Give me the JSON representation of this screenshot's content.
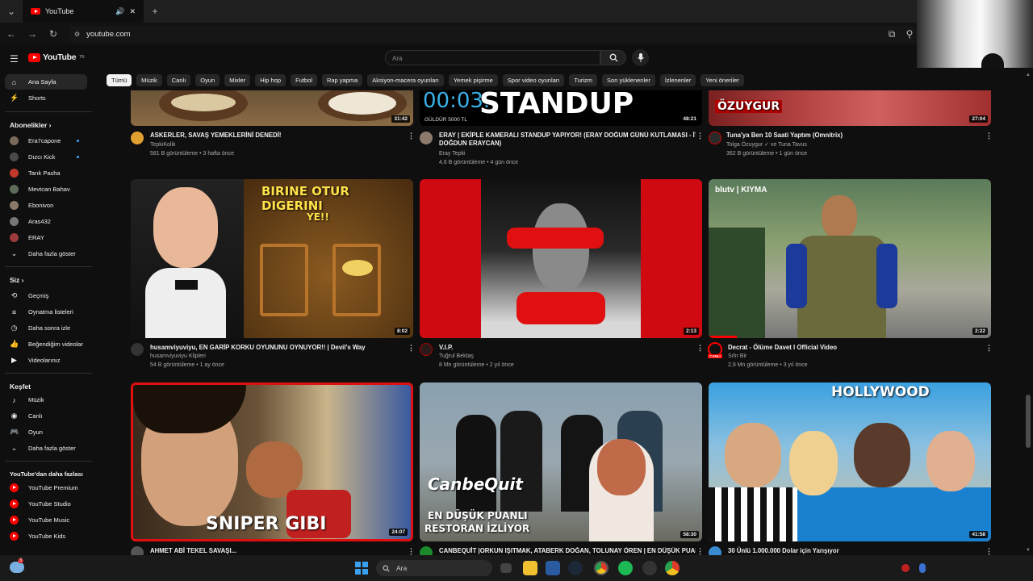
{
  "browser": {
    "tab_title": "YouTube",
    "url": "youtube.com"
  },
  "header": {
    "logo_text": "YouTube",
    "logo_country": "TR",
    "search_placeholder": "Ara"
  },
  "chips": [
    "Tümü",
    "Müzik",
    "Canlı",
    "Oyun",
    "Mixler",
    "Hip hop",
    "Futbol",
    "Rap yapma",
    "Aksiyon-macera oyunları",
    "Yemek pişirme",
    "Spor video oyunları",
    "Turizm",
    "Son yüklenenler",
    "İzlenenler",
    "Yeni öneriler"
  ],
  "sidebar": {
    "home": "Ana Sayfa",
    "shorts": "Shorts",
    "subs_header": "Abonelikler",
    "subs": [
      {
        "name": "Era7capone",
        "color": "#7a6a5a",
        "live": true
      },
      {
        "name": "Dızcı Kick",
        "color": "#4a4a4a",
        "live": true
      },
      {
        "name": "Tarık Pasha",
        "color": "#c0392b",
        "live": false
      },
      {
        "name": "Mevtcan Bahav",
        "color": "#5d6d5a",
        "live": false
      },
      {
        "name": "Ebonivon",
        "color": "#8a7a6a",
        "live": false
      },
      {
        "name": "Aras432",
        "color": "#777777",
        "live": false
      },
      {
        "name": "ERAY",
        "color": "#9b3b3b",
        "live": false
      }
    ],
    "subs_more": "Daha fazla göster",
    "you_header": "Siz",
    "you_items": [
      "Geçmiş",
      "Oynatma listeleri",
      "Daha sonra izle",
      "Beğendiğim videolar",
      "Videolarınız"
    ],
    "explore_header": "Keşfet",
    "explore_items": [
      "Müzik",
      "Canlı",
      "Oyun"
    ],
    "explore_more": "Daha fazla göster",
    "more_header": "YouTube'dan daha fazlası",
    "more_items": [
      "YouTube Premium",
      "YouTube Studio",
      "YouTube Music",
      "YouTube Kids"
    ]
  },
  "videos_row1": [
    {
      "title": "ASKERLER, SAVAŞ YEMEKLERİNİ DENEDİ!",
      "title2": "",
      "channel": "TepkiKolik",
      "meta": "581 B görüntüleme • 3 hafta önce",
      "duration": "31:42"
    },
    {
      "title": "ERAY | EKİPLE KAMERALI STANDUP YAPIYOR! (ERAY DOĞUM GÜNÜ KUTLAMASI - İYİKİ",
      "title2": "DOĞDUN ERAYCAN)",
      "channel": "Eray Tepki",
      "meta": "4,6 B görüntüleme • 4 gün önce",
      "duration": "48:21",
      "overlay": "STANDUP",
      "overlay_timer": "00:03.",
      "overlay_sub": "GÜLDÜR 5000 TL"
    },
    {
      "title": "Tuna'ya Ben 10 Saati Yaptım (Omnitrix)",
      "title2": "",
      "channel": "Tolga Özuygur ✓ ve Tuna Tavus",
      "meta": "362 B görüntüleme • 1 gün önce",
      "duration": "27:04",
      "overlay": "ÖZUYGUR"
    }
  ],
  "videos_row2": [
    {
      "title": "husamviyuviyu, EN GARİP KORKU OYUNUNU OYNUYOR!! | Devil's Way",
      "channel": "husamviyuviyu Klipleri",
      "meta": "54 B görüntüleme • 1 ay önce",
      "duration": "8:02",
      "overlay1": "BIRINE OTUR DIGERINI",
      "overlay2": "YE!!"
    },
    {
      "title": "V.I.P.",
      "channel": "Tuğrul Bektaş",
      "meta": "8 Mn görüntüleme • 2 yıl önce",
      "duration": "2:13"
    },
    {
      "title": "Decrat - Ölüme Davet I Official Video",
      "channel": "Sıfır Bir",
      "meta": "2,9 Mn görüntüleme • 3 yıl önce",
      "duration": "2:22",
      "overlay": "blutv | KIYMA",
      "live_badge": "CANLI"
    }
  ],
  "videos_row3": [
    {
      "title": "AHMET ABİ TEKEL SAVAŞI...",
      "duration": "24:07",
      "overlay": "SNIPER GIBI"
    },
    {
      "title": "CANBEQUİT |ORKUN IŞITMAK, ATABERK DOĞAN, TOLUNAY ÖREN | EN DÜŞÜK PUANLI",
      "duration": "58:30",
      "overlay1": "CanbeQuit",
      "overlay2": "EN DÜŞÜK PUANLI",
      "overlay3": "RESTORAN İZLİYOR"
    },
    {
      "title": "30 Ünlü 1.000.000 Dolar için Yarışıyor",
      "duration": "41:58",
      "overlay": "HOLLYWOOD"
    }
  ],
  "taskbar": {
    "search_placeholder": "Ara",
    "notif_count": "3"
  }
}
